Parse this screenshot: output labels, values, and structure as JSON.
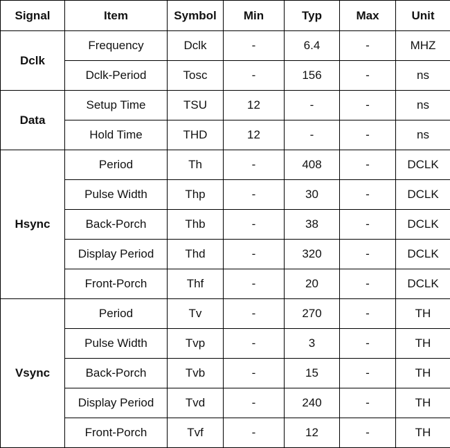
{
  "table": {
    "headers": [
      "Signal",
      "Item",
      "Symbol",
      "Min",
      "Typ",
      "Max",
      "Unit"
    ],
    "groups": [
      {
        "signal": "Dclk",
        "rows": [
          [
            "Frequency",
            "Dclk",
            "-",
            "6.4",
            "-",
            "MHZ"
          ],
          [
            "Dclk-Period",
            "Tosc",
            "-",
            "156",
            "-",
            "ns"
          ]
        ]
      },
      {
        "signal": "Data",
        "rows": [
          [
            "Setup Time",
            "TSU",
            "12",
            "-",
            "-",
            "ns"
          ],
          [
            "Hold Time",
            "THD",
            "12",
            "-",
            "-",
            "ns"
          ]
        ]
      },
      {
        "signal": "Hsync",
        "rows": [
          [
            "Period",
            "Th",
            "-",
            "408",
            "-",
            "DCLK"
          ],
          [
            "Pulse Width",
            "Thp",
            "-",
            "30",
            "-",
            "DCLK"
          ],
          [
            "Back-Porch",
            "Thb",
            "-",
            "38",
            "-",
            "DCLK"
          ],
          [
            "Display Period",
            "Thd",
            "-",
            "320",
            "-",
            "DCLK"
          ],
          [
            "Front-Porch",
            "Thf",
            "-",
            "20",
            "-",
            "DCLK"
          ]
        ]
      },
      {
        "signal": "Vsync",
        "rows": [
          [
            "Period",
            "Tv",
            "-",
            "270",
            "-",
            "TH"
          ],
          [
            "Pulse Width",
            "Tvp",
            "-",
            "3",
            "-",
            "TH"
          ],
          [
            "Back-Porch",
            "Tvb",
            "-",
            "15",
            "-",
            "TH"
          ],
          [
            "Display Period",
            "Tvd",
            "-",
            "240",
            "-",
            "TH"
          ],
          [
            "Front-Porch",
            "Tvf",
            "-",
            "12",
            "-",
            "TH"
          ]
        ]
      }
    ]
  }
}
